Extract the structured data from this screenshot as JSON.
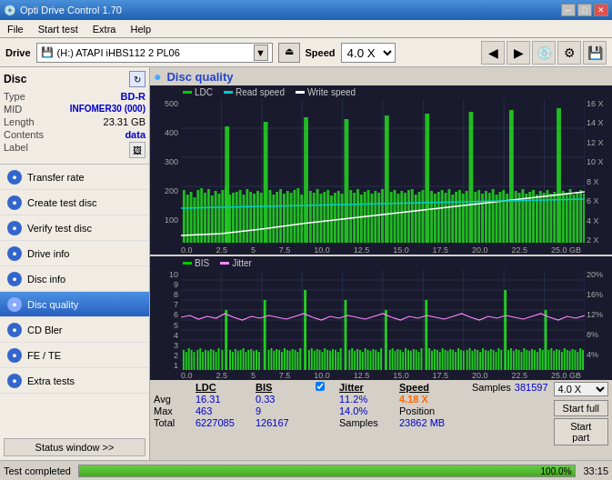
{
  "titleBar": {
    "title": "Opti Drive Control 1.70",
    "icon": "💿",
    "buttons": {
      "minimize": "─",
      "maximize": "□",
      "close": "✕"
    }
  },
  "menuBar": {
    "items": [
      "File",
      "Start test",
      "Extra",
      "Help"
    ]
  },
  "driveBar": {
    "label": "Drive",
    "driveIcon": "💾",
    "driveText": "(H:)  ATAPI iHBS112  2 PL06",
    "dropdownArrow": "▼",
    "ejectLabel": "⏏",
    "speedLabel": "Speed",
    "speedValue": "4.0 X",
    "arrowLeft": "◀",
    "arrowRight": "▶"
  },
  "discPanel": {
    "title": "Disc",
    "refreshIcon": "↻",
    "rows": [
      {
        "key": "Type",
        "value": "BD-R",
        "colored": true
      },
      {
        "key": "MID",
        "value": "INFOMER30 (000)",
        "colored": true
      },
      {
        "key": "Length",
        "value": "23.31 GB",
        "colored": false
      },
      {
        "key": "Contents",
        "value": "data",
        "colored": true
      },
      {
        "key": "Label",
        "value": "",
        "isIcon": true
      }
    ]
  },
  "navItems": [
    {
      "id": "transfer-rate",
      "label": "Transfer rate",
      "icon": "●"
    },
    {
      "id": "create-test-disc",
      "label": "Create test disc",
      "icon": "●"
    },
    {
      "id": "verify-test-disc",
      "label": "Verify test disc",
      "icon": "●"
    },
    {
      "id": "drive-info",
      "label": "Drive info",
      "icon": "●"
    },
    {
      "id": "disc-info",
      "label": "Disc info",
      "icon": "●"
    },
    {
      "id": "disc-quality",
      "label": "Disc quality",
      "icon": "●",
      "active": true
    },
    {
      "id": "cd-bler",
      "label": "CD Bler",
      "icon": "●"
    },
    {
      "id": "fe-te",
      "label": "FE / TE",
      "icon": "●"
    },
    {
      "id": "extra-tests",
      "label": "Extra tests",
      "icon": "●"
    }
  ],
  "statusButton": "Status window >>",
  "discQuality": {
    "title": "Disc quality",
    "chart1": {
      "legend": [
        {
          "color": "green",
          "label": "LDC"
        },
        {
          "color": "cyan",
          "label": "Read speed"
        },
        {
          "color": "white",
          "label": "Write speed"
        }
      ],
      "yAxisLeft": [
        "500",
        "400",
        "300",
        "200",
        "100"
      ],
      "yAxisRight": [
        "16 X",
        "14 X",
        "12 X",
        "10 X",
        "8 X",
        "6 X",
        "4 X",
        "2 X"
      ],
      "xAxis": [
        "0.0",
        "2.5",
        "5",
        "7.5",
        "10.0",
        "12.5",
        "15.0",
        "17.5",
        "20.0",
        "22.5",
        "25.0 GB"
      ]
    },
    "chart2": {
      "legend": [
        {
          "color": "green",
          "label": "BIS"
        },
        {
          "color": "pink",
          "label": "Jitter"
        }
      ],
      "yAxisLeft": [
        "10",
        "9",
        "8",
        "7",
        "6",
        "5",
        "4",
        "3",
        "2",
        "1"
      ],
      "yAxisRight": [
        "20%",
        "16%",
        "12%",
        "8%",
        "4%"
      ],
      "xAxis": [
        "0.0",
        "2.5",
        "5",
        "7.5",
        "10.0",
        "12.5",
        "15.0",
        "17.5",
        "20.0",
        "22.5",
        "25.0 GB"
      ]
    },
    "stats": {
      "headers": [
        "",
        "LDC",
        "BIS",
        "",
        "Jitter",
        "Speed",
        ""
      ],
      "avgLabel": "Avg",
      "avgLDC": "16.31",
      "avgBIS": "0.33",
      "avgJitter": "11.2%",
      "avgSpeed": "4.18 X",
      "maxLabel": "Max",
      "maxLDC": "463",
      "maxBIS": "9",
      "maxJitter": "14.0%",
      "position": "23862 MB",
      "totalLabel": "Total",
      "totalLDC": "6227085",
      "totalBIS": "126167",
      "samples": "381597",
      "jitterChecked": true,
      "jitterLabel": "Jitter",
      "speedLabel": "Speed",
      "speedVal": "4.18 X",
      "speedDropdown": "4.0 X",
      "positionLabel": "Position",
      "samplesLabel": "Samples",
      "startFull": "Start full",
      "startPart": "Start part"
    }
  },
  "statusBar": {
    "label": "Test completed",
    "progress": 100,
    "progressText": "100.0%",
    "time": "33:15"
  }
}
